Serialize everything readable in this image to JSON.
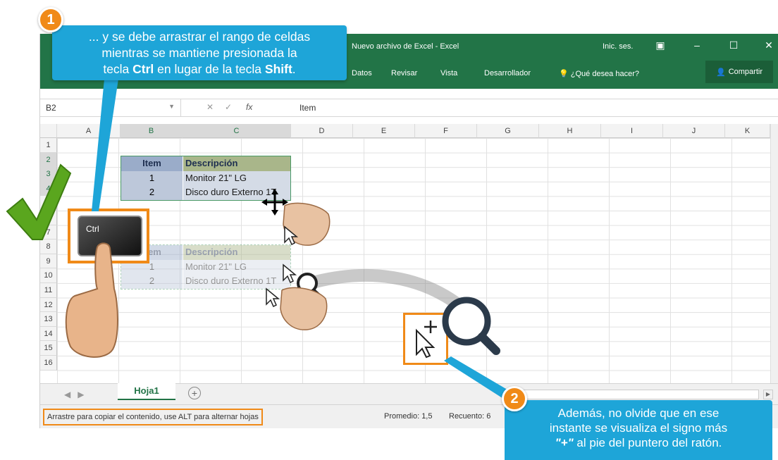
{
  "window": {
    "title": "Nuevo archivo de Excel - Excel",
    "signin": "Inic. ses.",
    "ribbon_tabs": [
      "Datos",
      "Revisar",
      "Vista",
      "Desarrollador"
    ],
    "tell_me": "¿Qué desea hacer?",
    "share": "Compartir",
    "accent_color": "#227447"
  },
  "formula_bar": {
    "name_box": "B2",
    "value": "Item"
  },
  "columns": [
    "A",
    "B",
    "C",
    "D",
    "E",
    "F",
    "G",
    "H",
    "I",
    "J",
    "K"
  ],
  "rows": [
    "1",
    "2",
    "3",
    "4",
    "5",
    "6",
    "7",
    "8",
    "9",
    "10",
    "11",
    "12",
    "13",
    "14",
    "15",
    "16"
  ],
  "table_original": {
    "header": [
      "Item",
      "Descripción"
    ],
    "rows": [
      [
        "1",
        "Monitor 21\" LG"
      ],
      [
        "2",
        "Disco duro Externo 1T"
      ]
    ]
  },
  "table_ghost": {
    "header": [
      "Item",
      "Descripción"
    ],
    "rows": [
      [
        "1",
        "Monitor 21\" LG"
      ],
      [
        "2",
        "Disco duro Externo 1T"
      ]
    ]
  },
  "sheets": {
    "active": "Hoja1"
  },
  "status": {
    "message": "Arrastre para copiar el contenido, use ALT para alternar hojas",
    "average": "Promedio: 1,5",
    "count": "Recuento: 6"
  },
  "callout1": {
    "number": "1",
    "line1": "... y se debe arrastrar el rango de celdas",
    "line2": "mientras se mantiene presionada la",
    "line3_pre": "tecla ",
    "line3_key1": "Ctrl",
    "line3_mid": " en lugar de la tecla ",
    "line3_key2": "Shift",
    "line3_end": "."
  },
  "callout2": {
    "number": "2",
    "line1": "Además, no olvide que en ese",
    "line2": "instante se visualiza el signo más",
    "line3_sym": "\"+\"",
    "line3_rest": " al pie del puntero del ratón."
  },
  "ctrl_key": "Ctrl",
  "icons": [
    "checkmark-icon",
    "move-cursor-icon",
    "magnifier-icon",
    "plus-cursor-icon",
    "hand-icon"
  ],
  "highlight_color": "#f08a18",
  "callout_color": "#1ea5d8"
}
